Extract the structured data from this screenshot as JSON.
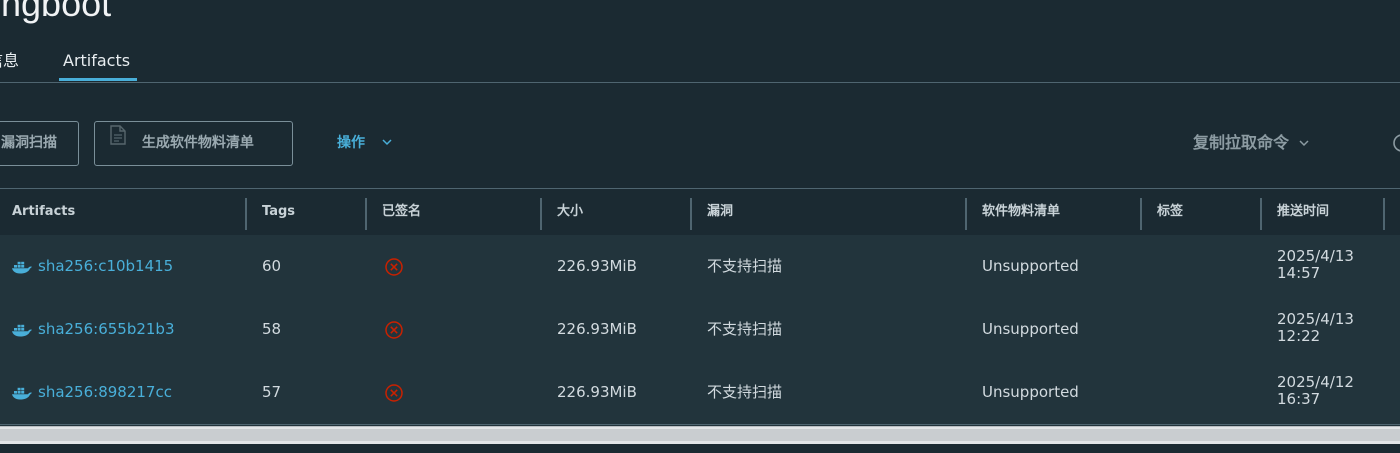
{
  "page": {
    "title": "ingboot"
  },
  "tabs": [
    {
      "label": "信息"
    },
    {
      "label": "Artifacts"
    }
  ],
  "toolbar": {
    "scan_label": "漏洞扫描",
    "sbom_label": "生成软件物料清单",
    "actions_label": "操作",
    "copy_pull_label": "复制拉取命令"
  },
  "table": {
    "columns": [
      "Artifacts",
      "Tags",
      "已签名",
      "大小",
      "漏洞",
      "软件物料清单",
      "标签",
      "推送时间"
    ],
    "rows": [
      {
        "digest": "sha256:c10b1415",
        "tags": "60",
        "signed": false,
        "size": "226.93MiB",
        "vulnerabilities": "不支持扫描",
        "sbom": "Unsupported",
        "labels": "",
        "push_date": "2025/4/13",
        "push_time": "14:57"
      },
      {
        "digest": "sha256:655b21b3",
        "tags": "58",
        "signed": false,
        "size": "226.93MiB",
        "vulnerabilities": "不支持扫描",
        "sbom": "Unsupported",
        "labels": "",
        "push_date": "2025/4/13",
        "push_time": "12:22"
      },
      {
        "digest": "sha256:898217cc",
        "tags": "57",
        "signed": false,
        "size": "226.93MiB",
        "vulnerabilities": "不支持扫描",
        "sbom": "Unsupported",
        "labels": "",
        "push_date": "2025/4/12",
        "push_time": "16:37"
      }
    ]
  },
  "icons": {
    "artifact": "docker-icon",
    "unsigned": "circle-x-icon",
    "sbom_button": "document-icon",
    "dropdown": "chevron-down-icon"
  },
  "colors": {
    "background": "#1b2a32",
    "row_background": "#22343c",
    "accent": "#49afd9",
    "danger": "#c92100",
    "border": "#4f6570"
  }
}
